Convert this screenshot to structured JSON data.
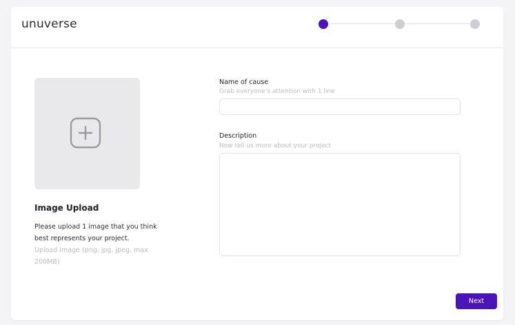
{
  "app": {
    "logo_text": "unuverse"
  },
  "stepper": {
    "steps": [
      {
        "state": "active"
      },
      {
        "state": "inactive"
      },
      {
        "state": "inactive"
      }
    ],
    "current_step": 1,
    "total_steps": 3,
    "active_color": "#4a14b8",
    "inactive_color": "#cdcdd2"
  },
  "upload": {
    "icon": "plus-icon",
    "title": "Image Upload",
    "description": "Please upload 1 image that you think best represents your project.",
    "hint": "Upload image (png, jpg, jpeg. max 200MB)"
  },
  "form": {
    "name": {
      "label": "Name of cause",
      "sublabel": "Grab everyone's attention with 1 line",
      "value": ""
    },
    "description": {
      "label": "Description",
      "sublabel": "Now tell us more about your project",
      "value": ""
    }
  },
  "actions": {
    "next_label": "Next",
    "accent_color": "#4a14b8"
  }
}
